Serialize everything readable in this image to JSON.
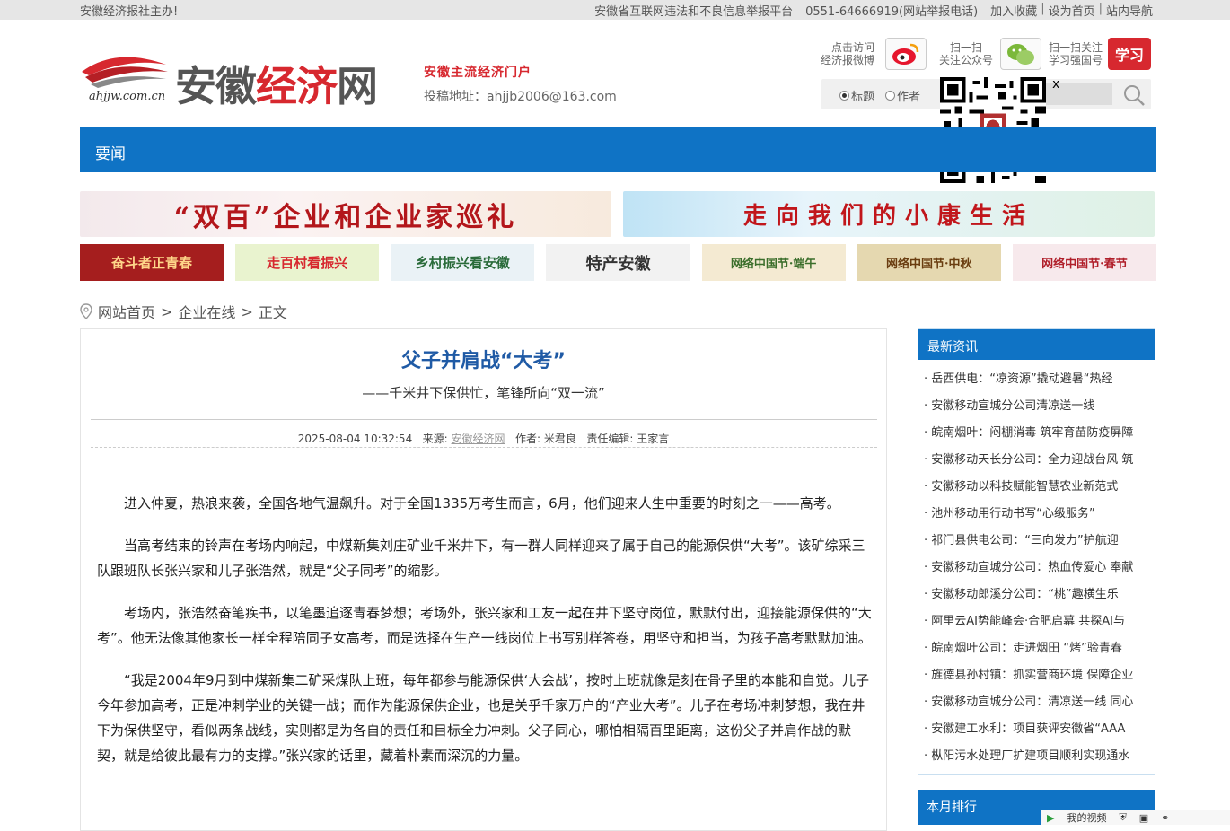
{
  "topbar": {
    "left": "安徽经济报社主办!",
    "report_platform": "安徽省互联网违法和不良信息举报平台",
    "report_phone": "0551-64666919(网站举报电话)",
    "links": [
      "加入收藏",
      "设为首页",
      "站内导航"
    ]
  },
  "header": {
    "logo_domain": "ahjjw.com.cn",
    "logo_name_gray1": "安徽",
    "logo_name_red": "经济",
    "logo_name_gray2": "网",
    "slogan": "安徽主流经济门户",
    "submit_email": "投稿地址：ahjjb2006@163.com",
    "weibo_label_1": "点击访问",
    "weibo_label_2": "经济报微博",
    "wechat_label_1": "扫一扫",
    "wechat_label_2": "关注公众号",
    "xuexi_label_1": "扫一扫关注",
    "xuexi_label_2": "学习强国号",
    "xuexi_badge": "学习"
  },
  "search": {
    "option_title": "标题",
    "option_author": "作者",
    "selected": "标题",
    "placeholder": ""
  },
  "qr_close": "x",
  "nav": {
    "items": [
      "要闻"
    ]
  },
  "banners": {
    "big": [
      "“双百”企业和企业家巡礼",
      "走向我们的小康生活"
    ],
    "small": [
      "奋斗者正青春",
      "走百村看振兴",
      "乡村振兴看安徽",
      "特产安徽",
      "网络中国节·端午",
      "网络中国节·中秋",
      "网络中国节·春节"
    ]
  },
  "breadcrumb": [
    "网站首页",
    "企业在线",
    "正文"
  ],
  "article": {
    "title": "父子并肩战“大考”",
    "subtitle": "——千米井下保供忙，笔锋所向“双一流”",
    "datetime": "2025-08-04 10:32:54",
    "source_label": "来源:",
    "source": "安徽经济网",
    "author_label": "作者:",
    "author": "米君良",
    "editor_label": "责任编辑:",
    "editor": "王家言",
    "paragraphs": [
      "进入仲夏，热浪来袭，全国各地气温飙升。对于全国1335万考生而言，6月，他们迎来人生中重要的时刻之一——高考。",
      "当高考结束的铃声在考场内响起，中煤新集刘庄矿业千米井下，有一群人同样迎来了属于自己的能源保供“大考”。该矿综采三队跟班队长张兴家和儿子张浩然，就是“父子同考”的缩影。",
      "考场内，张浩然奋笔疾书，以笔墨追逐青春梦想；考场外，张兴家和工友一起在井下坚守岗位，默默付出，迎接能源保供的“大考”。他无法像其他家长一样全程陪同子女高考，而是选择在生产一线岗位上书写别样答卷，用坚守和担当，为孩子高考默默加油。",
      "“我是2004年9月到中煤新集二矿采煤队上班，每年都参与能源保供‘大会战’，按时上班就像是刻在骨子里的本能和自觉。儿子今年参加高考，正是冲刺学业的关键一战；而作为能源保供企业，也是关乎千家万户的“产业大考”。儿子在考场冲刺梦想，我在井下为保供坚守，看似两条战线，实则都是为各自的责任和目标全力冲刺。父子同心，哪怕相隔百里距离，这份父子并肩作战的默契，就是给彼此最有力的支撑。”张兴家的话里，藏着朴素而深沉的力量。"
    ]
  },
  "sidebar": {
    "latest_title": "最新资讯",
    "latest": [
      "· 岳西供电：“凉资源”撬动避暑“热经",
      "· 安徽移动宣城分公司清凉送一线",
      "· 皖南烟叶：闷棚消毒 筑牢育苗防疫屏障",
      "· 安徽移动天长分公司：全力迎战台风 筑",
      "· 安徽移动以科技赋能智慧农业新范式",
      "· 池州移动用行动书写“心级服务”",
      "· 祁门县供电公司：“三向发力”护航迎",
      "· 安徽移动宣城分公司：热血传爱心 奉献",
      "· 安徽移动郎溪分公司：“桃”趣横生乐",
      "· 阿里云AI势能峰会·合肥启幕 共探AI与",
      "· 皖南烟叶公司：走进烟田 “烤”验青春",
      "· 旌德县孙村镇：抓实营商环境 保障企业",
      "· 安徽移动宣城分公司：清凉送一线 同心",
      "· 安徽建工水利：项目获评安徽省“AAA",
      "· 枞阳污水处理厂扩建项目顺利实现通水"
    ],
    "monthly_title": "本月排行"
  },
  "statusbar": {
    "video_label": "我的视频"
  }
}
